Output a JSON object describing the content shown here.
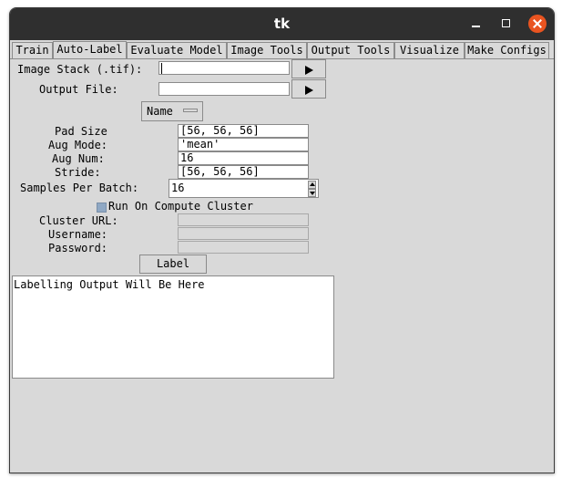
{
  "window": {
    "title": "tk"
  },
  "tabs": [
    {
      "label": "Train",
      "selected": false
    },
    {
      "label": "Auto-Label",
      "selected": true
    },
    {
      "label": "Evaluate Model",
      "selected": false
    },
    {
      "label": "Image Tools",
      "selected": false
    },
    {
      "label": "Output Tools",
      "selected": false
    },
    {
      "label": "Visualize",
      "selected": false
    },
    {
      "label": "Make Configs",
      "selected": false
    }
  ],
  "form": {
    "image_stack_label": "Image Stack (.tif):",
    "image_stack_value": "",
    "output_file_label": "Output File:",
    "output_file_value": "",
    "name_button_label": "Name",
    "pad_size_label": "Pad Size",
    "pad_size_value": "[56, 56, 56]",
    "aug_mode_label": "Aug Mode:",
    "aug_mode_value": "'mean'",
    "aug_num_label": "Aug Num:",
    "aug_num_value": "16",
    "stride_label": "Stride:",
    "stride_value": "[56, 56, 56]",
    "samples_per_batch_label": "Samples Per Batch:",
    "samples_per_batch_value": "16",
    "cluster_checkbox_label": "Run On Compute Cluster",
    "cluster_checkbox_checked": false,
    "cluster_url_label": "Cluster URL:",
    "username_label": "Username:",
    "password_label": "Password:",
    "label_button": "Label"
  },
  "output": {
    "text": "Labelling Output Will Be Here"
  },
  "icons": {
    "browse": "play-icon",
    "close": "close-icon",
    "minimize": "minimize-icon",
    "maximize": "maximize-icon"
  },
  "colors": {
    "titlebar": "#2f2f2f",
    "close_button": "#e95420",
    "background": "#d9d9d9",
    "checkbox": "#8fa8c4"
  }
}
